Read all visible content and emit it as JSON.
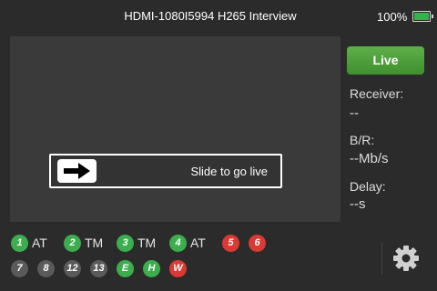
{
  "header": {
    "title": "HDMI-1080I5994 H265 Interview",
    "battery_text": "100%",
    "battery_level": 1.0,
    "battery_color": "#32b44a"
  },
  "preview": {
    "slider_label": "Slide to go live",
    "handle_icon": "arrow-right-icon"
  },
  "live_button": {
    "label": "Live",
    "color": "#4fa23d"
  },
  "stats": {
    "receiver_label": "Receiver:",
    "receiver_value": "--",
    "br_label": "B/R:",
    "br_value": "--Mb/s",
    "delay_label": "Delay:",
    "delay_value": "--s"
  },
  "channels": [
    {
      "num": "1",
      "mode": "AT",
      "color": "green"
    },
    {
      "num": "2",
      "mode": "TM",
      "color": "green"
    },
    {
      "num": "3",
      "mode": "TM",
      "color": "green"
    },
    {
      "num": "4",
      "mode": "AT",
      "color": "green"
    },
    {
      "num": "5",
      "mode": "",
      "color": "red"
    },
    {
      "num": "6",
      "mode": "",
      "color": "red"
    },
    {
      "num": "7",
      "mode": "",
      "color": "grey"
    },
    {
      "num": "8",
      "mode": "",
      "color": "grey"
    },
    {
      "num": "12",
      "mode": "",
      "color": "grey"
    },
    {
      "num": "13",
      "mode": "",
      "color": "grey"
    },
    {
      "num": "E",
      "mode": "",
      "color": "green"
    },
    {
      "num": "H",
      "mode": "",
      "color": "green"
    },
    {
      "num": "W",
      "mode": "",
      "color": "red"
    }
  ],
  "settings_icon": "gear-icon"
}
